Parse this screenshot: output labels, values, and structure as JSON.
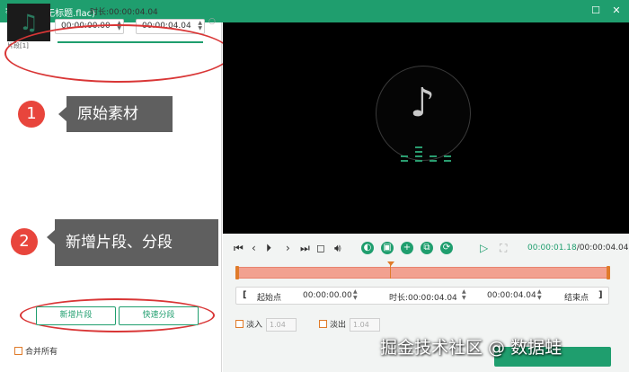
{
  "window": {
    "title": "剪辑 (无标题.flac)",
    "app_icon": "scissors-icon",
    "maximize_icon": "maximize-icon",
    "close_icon": "close-icon"
  },
  "clip": {
    "label": "片段[1]",
    "thumb_icon": "music-note-icon",
    "duration_label": "时长:",
    "duration_value": "00:00:04.04",
    "start_time": "00:00:00.00",
    "separator": "–",
    "end_time": "00:00:04.04"
  },
  "annotations": [
    {
      "number": "1",
      "text": "原始素材"
    },
    {
      "number": "2",
      "text": "新增片段、分段"
    }
  ],
  "left_actions": {
    "add_segment": "新增片段",
    "quick_split": "快速分段",
    "merge_all": "合并所有"
  },
  "preview": {
    "center_icon": "music-note-icon"
  },
  "playback": {
    "current_time": "00:00:01.18",
    "total_time": "/00:00:04.04"
  },
  "trim": {
    "open_bracket": "[",
    "start_point_label": "起始点",
    "start_value": "00:00:00.00",
    "duration_label": "时长:",
    "duration_value": "00:00:04.04",
    "end_value": "00:00:04.04",
    "end_point_label": "结束点",
    "close_bracket": "]"
  },
  "fade": {
    "fade_in_label": "淡入",
    "fade_in_value": "1.04",
    "fade_out_label": "淡出",
    "fade_out_value": "1.04"
  },
  "watermark": "掘金技术社区 @ 数据蛙",
  "colors": {
    "brand": "#1f9e6e",
    "annotation": "#e8453c",
    "timeline": "#f2a190",
    "accent": "#e07b2a"
  }
}
